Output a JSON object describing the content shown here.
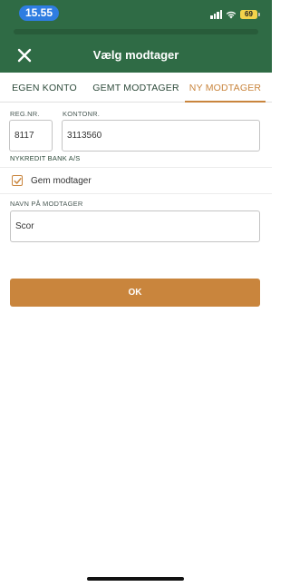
{
  "status_bar": {
    "time": "15.55",
    "battery": "69"
  },
  "header": {
    "title": "Vælg modtager"
  },
  "tabs": [
    {
      "label": "EGEN KONTO"
    },
    {
      "label": "GEMT MODTAGER"
    },
    {
      "label": "NY MODTAGER",
      "active": true
    }
  ],
  "form": {
    "reg_label": "REG.NR.",
    "reg_value": "8117",
    "account_label": "KONTONR.",
    "account_value": "3113560",
    "bank_name": "NYKREDIT BANK A/S",
    "save_label": "Gem modtager",
    "save_checked": true,
    "name_label": "NAVN PÅ MODTAGER",
    "name_value": "Scor"
  },
  "ok_label": "OK",
  "colors": {
    "header": "#2f6b45",
    "accent": "#c9853d",
    "time_pill": "#2f7de1"
  }
}
